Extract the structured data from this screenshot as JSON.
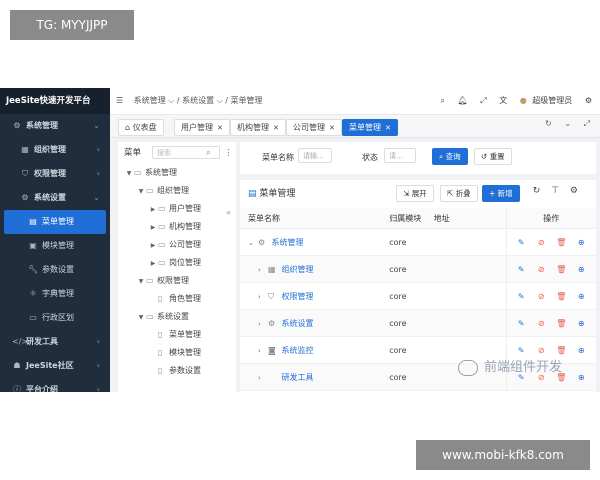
{
  "watermarks": {
    "top": "TG: MYYJJPP",
    "bottom": "www.mobi-kfk8.com",
    "middle": "前端组件开发"
  },
  "brand": "JeeSite快速开发平台",
  "sidebar": {
    "items": [
      {
        "label": "系统管理",
        "icon": "gear-icon",
        "level": 0
      },
      {
        "label": "组织管理",
        "icon": "grid-icon",
        "level": 1
      },
      {
        "label": "权限管理",
        "icon": "shield-icon",
        "level": 1
      },
      {
        "label": "系统设置",
        "icon": "gear-icon",
        "level": 1
      },
      {
        "label": "菜单管理",
        "icon": "menu-book-icon",
        "level": 2,
        "active": true
      },
      {
        "label": "模块管理",
        "icon": "module-icon",
        "level": 2
      },
      {
        "label": "参数设置",
        "icon": "wrench-icon",
        "level": 2
      },
      {
        "label": "字典管理",
        "icon": "dict-icon",
        "level": 2
      },
      {
        "label": "行政区划",
        "icon": "map-icon",
        "level": 2
      },
      {
        "label": "研发工具",
        "icon": "code-icon",
        "level": 0
      },
      {
        "label": "JeeSite社区",
        "icon": "community-icon",
        "level": 0
      },
      {
        "label": "平台介绍",
        "icon": "info-icon",
        "level": 0
      }
    ]
  },
  "topbar": {
    "breadcrumb": [
      "系统管理",
      "系统设置",
      "菜单管理"
    ],
    "user": "超级管理员"
  },
  "tabs": [
    {
      "label": "仪表盘",
      "closable": false
    },
    {
      "label": "用户管理",
      "closable": true
    },
    {
      "label": "机构管理",
      "closable": true
    },
    {
      "label": "公司管理",
      "closable": true
    },
    {
      "label": "菜单管理",
      "closable": true,
      "active": true
    }
  ],
  "tree": {
    "title": "菜单",
    "search_placeholder": "搜索",
    "nodes": [
      {
        "label": "系统管理",
        "depth": 0,
        "expanded": true
      },
      {
        "label": "组织管理",
        "depth": 1,
        "expanded": true
      },
      {
        "label": "用户管理",
        "depth": 2,
        "expanded": false
      },
      {
        "label": "机构管理",
        "depth": 2,
        "expanded": false
      },
      {
        "label": "公司管理",
        "depth": 2,
        "expanded": false
      },
      {
        "label": "岗位管理",
        "depth": 2,
        "expanded": false
      },
      {
        "label": "权限管理",
        "depth": 1,
        "expanded": true
      },
      {
        "label": "角色管理",
        "depth": 2,
        "leaf": true
      },
      {
        "label": "系统设置",
        "depth": 1,
        "expanded": true
      },
      {
        "label": "菜单管理",
        "depth": 2,
        "leaf": true
      },
      {
        "label": "模块管理",
        "depth": 2,
        "leaf": true
      },
      {
        "label": "参数设置",
        "depth": 2,
        "leaf": true
      }
    ]
  },
  "search": {
    "name_label": "菜单名称",
    "name_placeholder": "请输...",
    "status_label": "状态",
    "status_placeholder": "请...",
    "query_button": "查询",
    "reset_button": "重置"
  },
  "panel": {
    "title": "菜单管理",
    "expand_button": "展开",
    "collapse_button": "折叠",
    "add_button": "新增"
  },
  "table": {
    "headers": {
      "name": "菜单名称",
      "module": "归属模块",
      "address": "地址",
      "ops": "操作"
    },
    "rows": [
      {
        "name": "系统管理",
        "module": "core",
        "address": "",
        "icon": "gear-icon",
        "expanded": true,
        "indent": 0
      },
      {
        "name": "组织管理",
        "module": "core",
        "address": "",
        "icon": "grid-icon",
        "expanded": false,
        "indent": 1
      },
      {
        "name": "权限管理",
        "module": "core",
        "address": "",
        "icon": "shield-icon",
        "expanded": false,
        "indent": 1
      },
      {
        "name": "系统设置",
        "module": "core",
        "address": "",
        "icon": "gear-icon",
        "expanded": false,
        "indent": 1
      },
      {
        "name": "系统监控",
        "module": "core",
        "address": "",
        "icon": "monitor-icon",
        "expanded": false,
        "indent": 1
      },
      {
        "name": "研发工具",
        "module": "core",
        "address": "",
        "icon": "code-icon",
        "expanded": false,
        "indent": 1
      }
    ]
  },
  "colors": {
    "accent": "#1f6fd6",
    "sidebar": "#1f2d3d",
    "danger": "#e6604f"
  }
}
